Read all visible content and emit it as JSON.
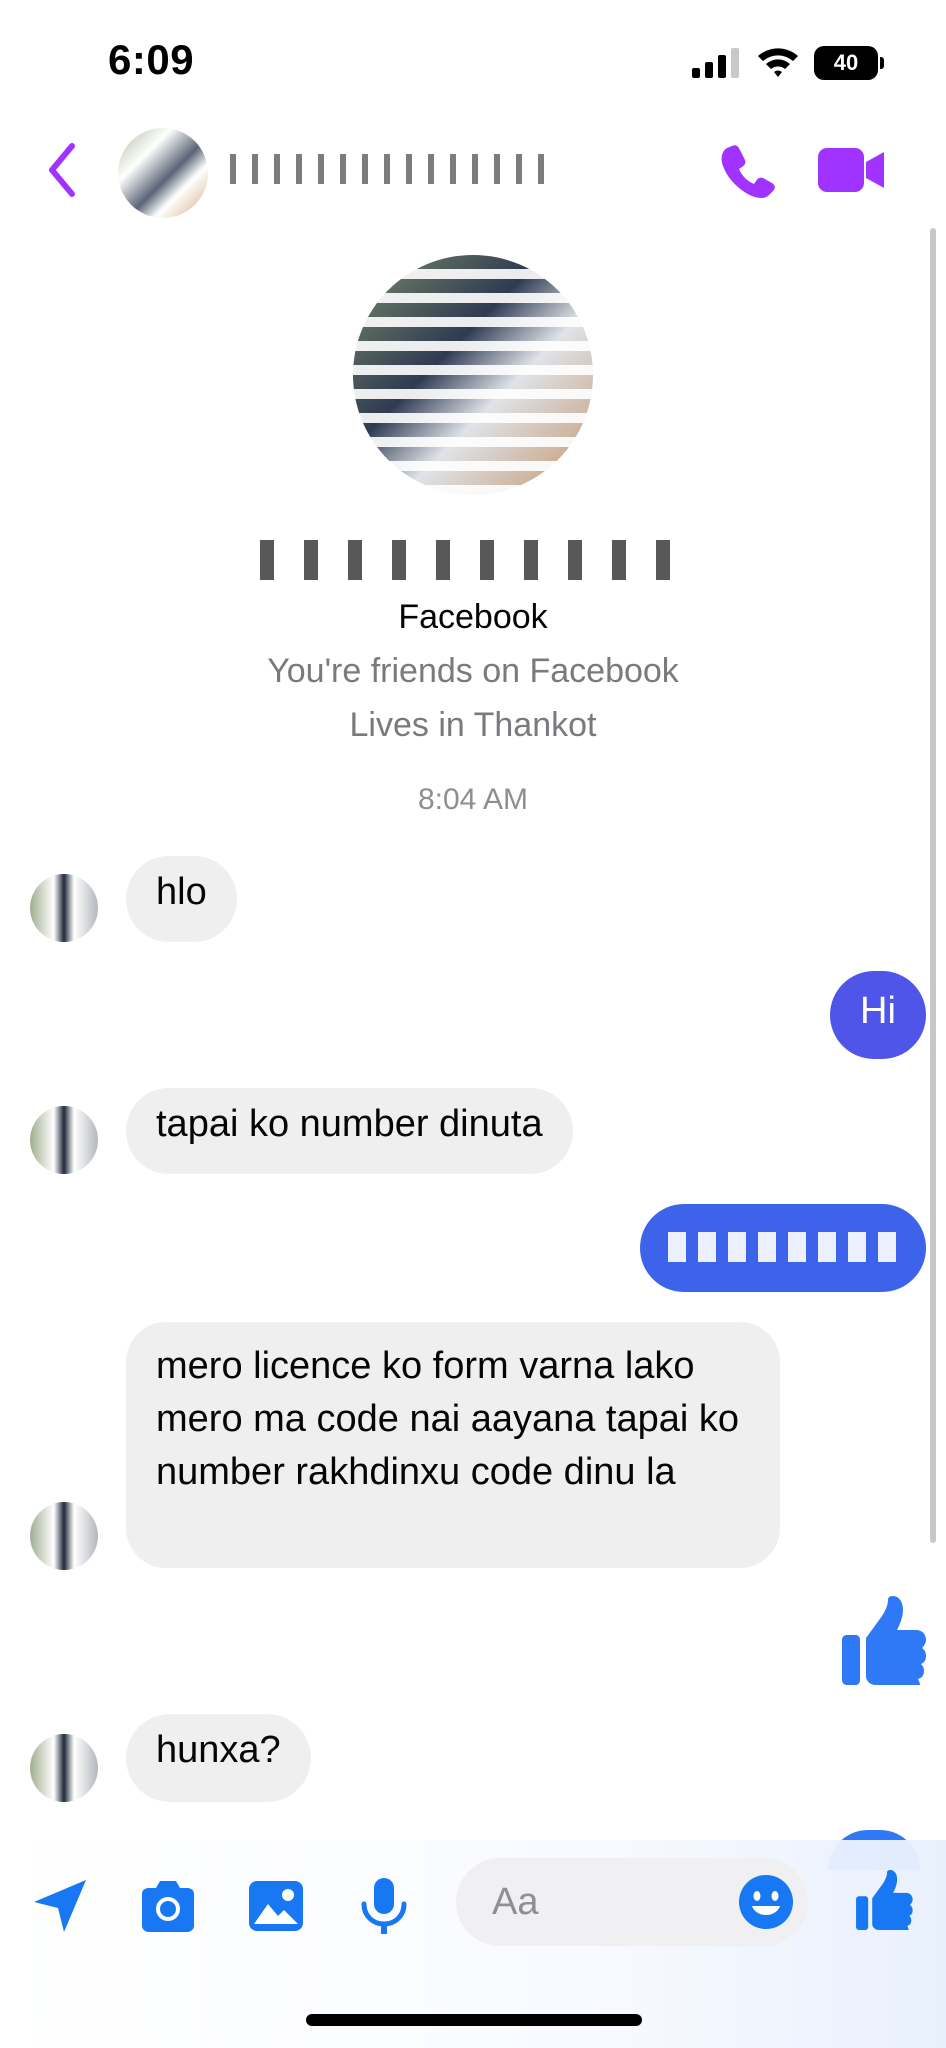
{
  "status_bar": {
    "time": "6:09",
    "battery": "40"
  },
  "header": {
    "contact_name": ""
  },
  "profile": {
    "name": "",
    "platform": "Facebook",
    "friends_line": "You're friends on Facebook",
    "location_line": "Lives in Thankot"
  },
  "conversation": {
    "timestamp": "8:04 AM",
    "messages": [
      {
        "direction": "in",
        "text": "hlo"
      },
      {
        "direction": "out",
        "text": "Hi"
      },
      {
        "direction": "in",
        "text": "tapai ko number dinuta"
      },
      {
        "direction": "out",
        "text": ""
      },
      {
        "direction": "in",
        "text": "mero licence ko form varna lako mero ma code nai aayana tapai ko number rakhdinxu code dinu la"
      },
      {
        "direction": "out",
        "type": "like",
        "icon": "thumbs-up-icon"
      },
      {
        "direction": "in",
        "text": "hunxa?"
      }
    ]
  },
  "composer": {
    "placeholder": "Aa",
    "icons": [
      "send-location-icon",
      "camera-icon",
      "gallery-icon",
      "microphone-icon",
      "emoji-icon",
      "thumbs-up-icon"
    ]
  },
  "colors": {
    "header_accent": "#a033ff",
    "outgoing_bubble": "#4e55e8",
    "incoming_bubble": "#efefef",
    "composer_icon": "#1877f2"
  }
}
